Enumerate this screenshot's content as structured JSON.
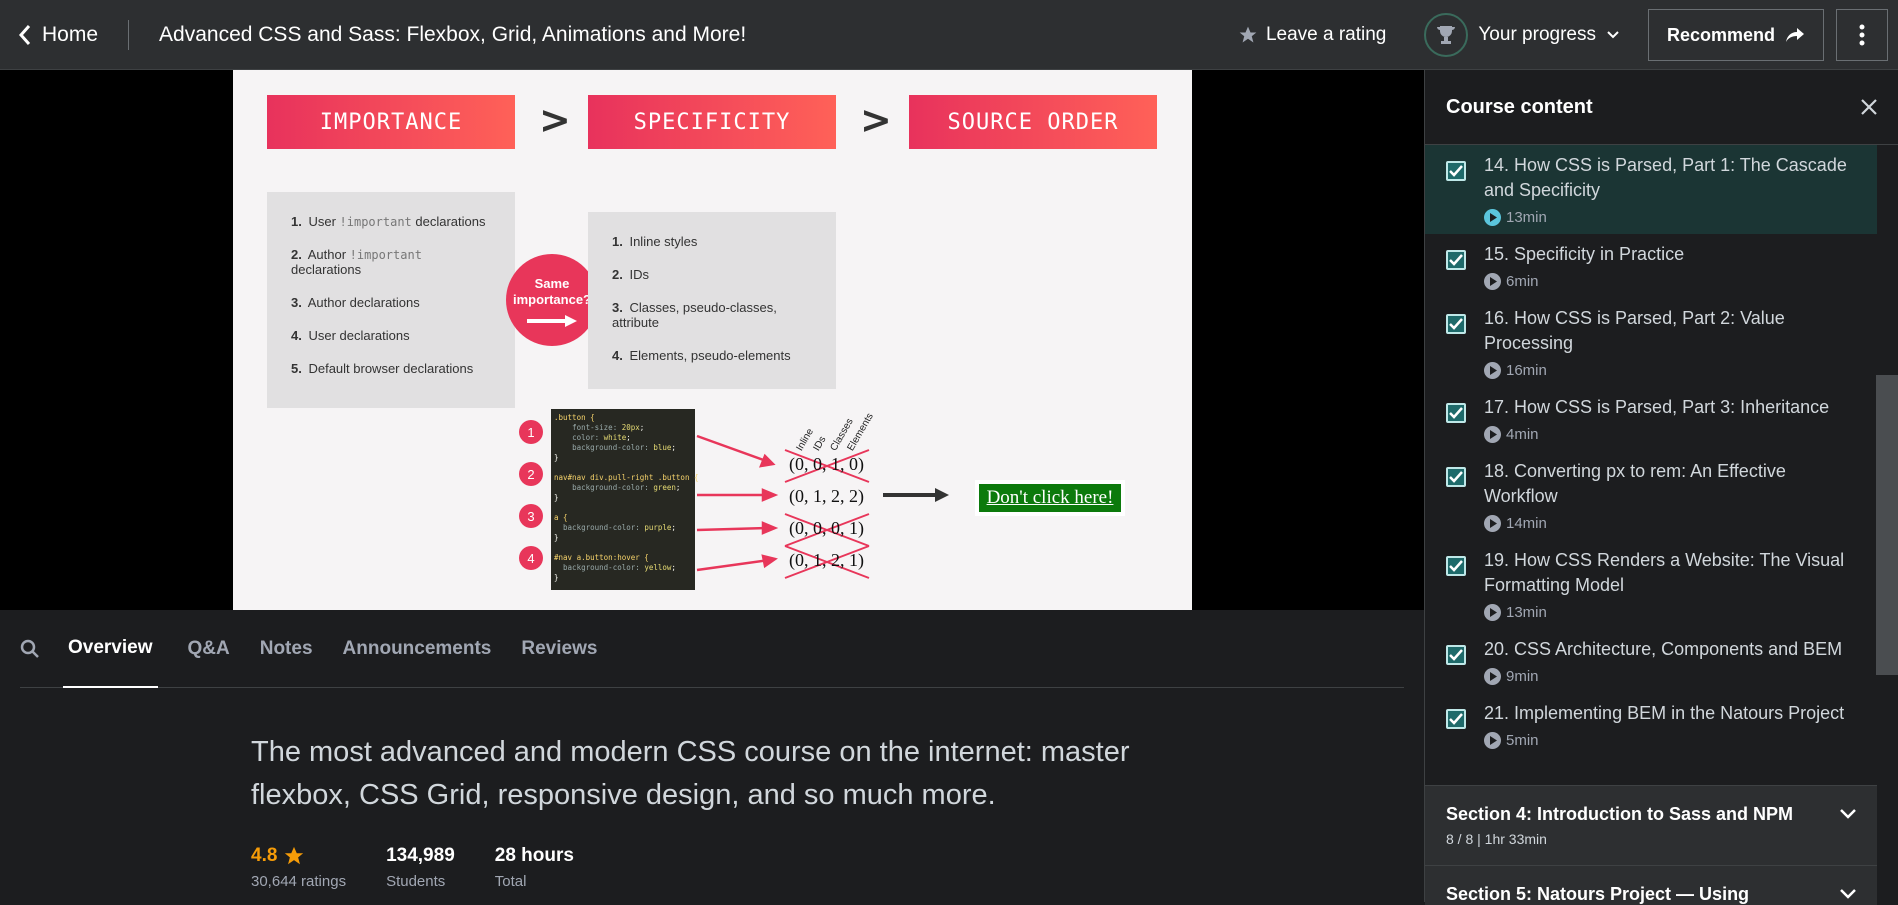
{
  "header": {
    "home_label": "Home",
    "course_title": "Advanced CSS and Sass: Flexbox, Grid, Animations and More!",
    "rating_label": "Leave a rating",
    "progress_label": "Your progress",
    "recommend_label": "Recommend"
  },
  "slide": {
    "boxes": [
      "IMPORTANCE",
      "SPECIFICITY",
      "SOURCE ORDER"
    ],
    "gt": ">",
    "importance_list": [
      {
        "n": "1.",
        "pre": "User ",
        "mono": "!important",
        "post": " declarations"
      },
      {
        "n": "2.",
        "pre": "Author ",
        "mono": "!important",
        "post": " declarations"
      },
      {
        "n": "3.",
        "pre": "Author declarations",
        "mono": "",
        "post": ""
      },
      {
        "n": "4.",
        "pre": "User declarations",
        "mono": "",
        "post": ""
      },
      {
        "n": "5.",
        "pre": "Default browser declarations",
        "mono": "",
        "post": ""
      }
    ],
    "same_importance": [
      "Same",
      "importance?"
    ],
    "specificity_list": [
      {
        "n": "1.",
        "text": "Inline styles"
      },
      {
        "n": "2.",
        "text": "IDs"
      },
      {
        "n": "3.",
        "text": "Classes, pseudo-classes, attribute"
      },
      {
        "n": "4.",
        "text": "Elements, pseudo-elements"
      }
    ],
    "column_heads": [
      "Inline",
      "IDs",
      "Classes",
      "Elements"
    ],
    "numbers": [
      "1",
      "2",
      "3",
      "4"
    ],
    "scores": [
      "(0, 0, 1, 0)",
      "(0, 1, 2, 2)",
      "(0, 0, 0, 1)",
      "(0, 1, 2, 1)"
    ],
    "button_text": "Don't click here!",
    "code": {
      "b1_sel": ".button {",
      "b1_l1_p": "font-size: ",
      "b1_l1_v": "20px",
      "b1_l1_e": ";",
      "b1_l2_p": "color: ",
      "b1_l2_v": "white",
      "b1_l2_e": ";",
      "b1_l3_p": "background-color: ",
      "b1_l3_v": "blue",
      "b1_l3_e": ";",
      "b2_sel": "nav#nav div.pull-right .button {",
      "b2_l1_p": "background-color: ",
      "b2_l1_v": "green",
      "b2_l1_e": ";",
      "b3_sel": "a {",
      "b3_l1_p": "background-color: ",
      "b3_l1_v": "purple",
      "b3_l1_e": ";",
      "b4_sel": "#nav a.button:hover {",
      "b4_l1_p": "background-color: ",
      "b4_l1_v": "yellow",
      "b4_l1_e": ";",
      "close": "}"
    }
  },
  "tabs": [
    "Overview",
    "Q&A",
    "Notes",
    "Announcements",
    "Reviews"
  ],
  "overview": {
    "description": "The most advanced and modern CSS course on the internet: master flexbox, CSS Grid, responsive design, and so much more.",
    "rating": "4.8",
    "ratings_count": "30,644 ratings",
    "students": "134,989",
    "students_label": "Students",
    "total": "28 hours",
    "total_label": "Total"
  },
  "sidebar": {
    "title": "Course content",
    "lessons": [
      {
        "title": "14. How CSS is Parsed, Part 1: The Cascade and Specificity",
        "duration": "13min"
      },
      {
        "title": "15. Specificity in Practice",
        "duration": "6min"
      },
      {
        "title": "16. How CSS is Parsed, Part 2: Value Processing",
        "duration": "16min"
      },
      {
        "title": "17. How CSS is Parsed, Part 3: Inheritance",
        "duration": "4min"
      },
      {
        "title": "18. Converting px to rem: An Effective Workflow",
        "duration": "14min"
      },
      {
        "title": "19. How CSS Renders a Website: The Visual Formatting Model",
        "duration": "13min"
      },
      {
        "title": "20. CSS Architecture, Components and BEM",
        "duration": "9min"
      },
      {
        "title": "21. Implementing BEM in the Natours Project",
        "duration": "5min"
      }
    ],
    "section4_title": "Section 4: Introduction to Sass and NPM",
    "section4_sub": "8 / 8 | 1hr 33min",
    "section5_title": "Section 5: Natours Project — Using"
  },
  "colors": {
    "accent": "#e8365a",
    "rating": "#f69c08",
    "active_lesson": "#1b3534"
  }
}
